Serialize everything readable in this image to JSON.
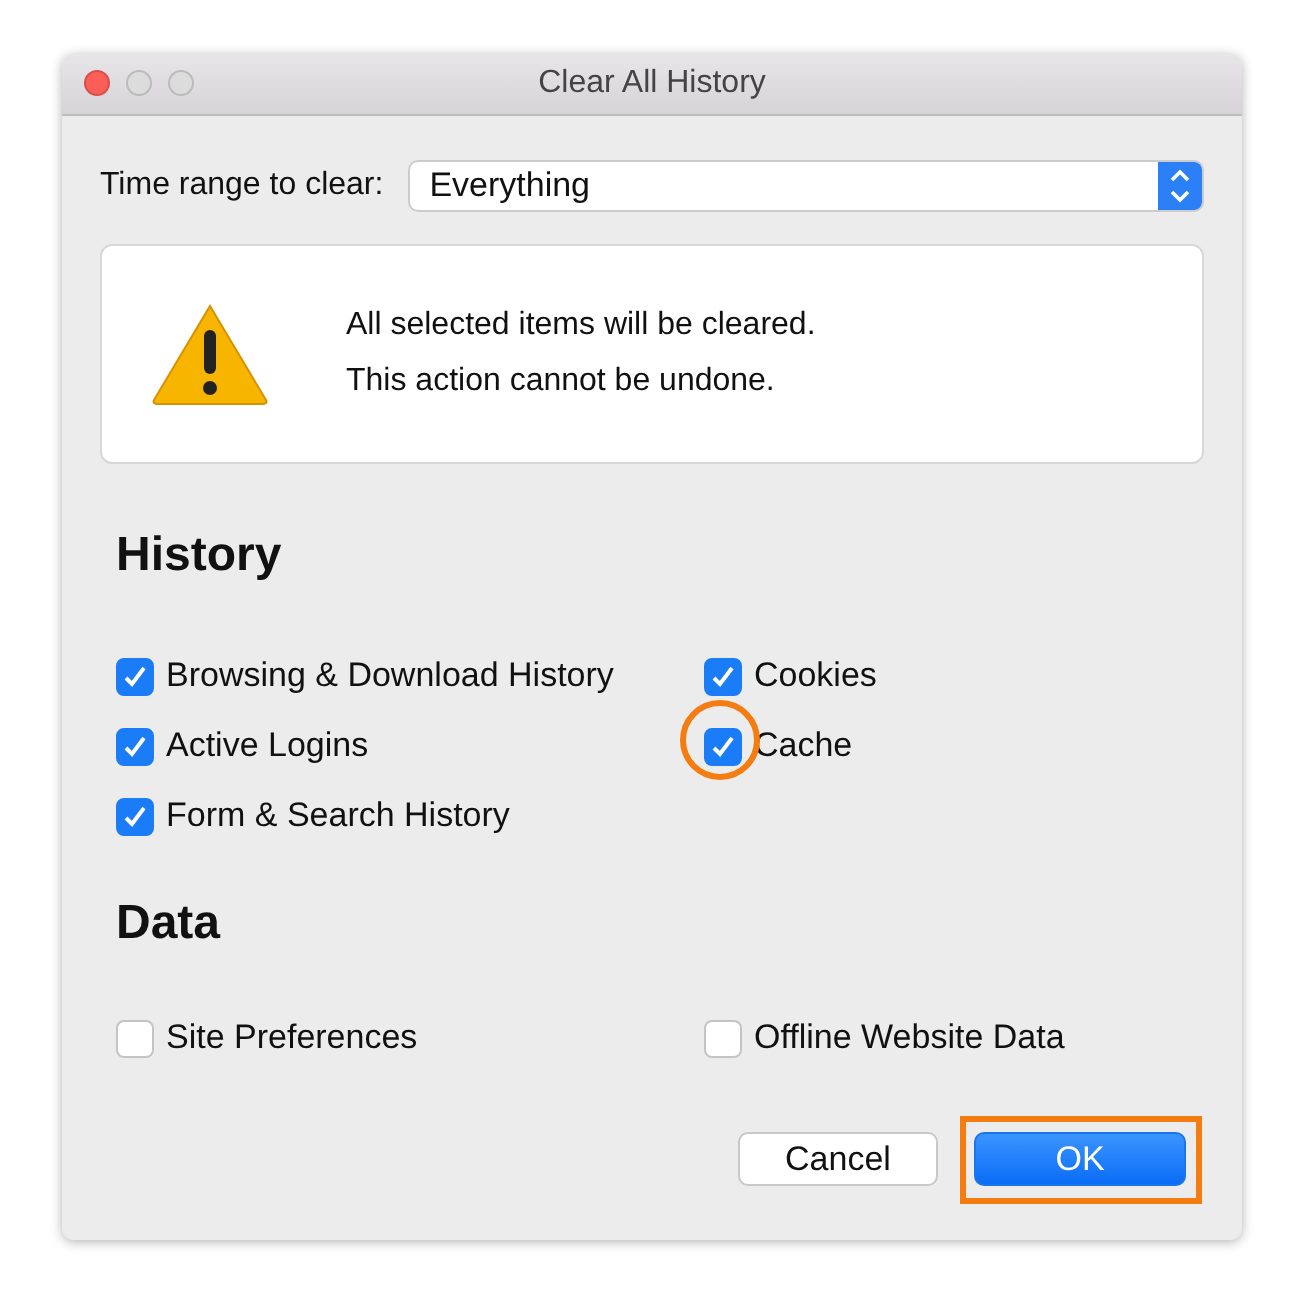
{
  "window": {
    "title": "Clear All History"
  },
  "time_range": {
    "label": "Time range to clear:",
    "value": "Everything"
  },
  "warning": {
    "lines": [
      "All selected items will be cleared.",
      "This action cannot be undone."
    ]
  },
  "sections": [
    {
      "heading": "History",
      "items": [
        {
          "label": "Browsing & Download History",
          "checked": true,
          "highlighted": false
        },
        {
          "label": "Cookies",
          "checked": true,
          "highlighted": false
        },
        {
          "label": "Active Logins",
          "checked": true,
          "highlighted": false
        },
        {
          "label": "Cache",
          "checked": true,
          "highlighted": true
        },
        {
          "label": "Form & Search History",
          "checked": true,
          "highlighted": false
        }
      ]
    },
    {
      "heading": "Data",
      "items": [
        {
          "label": "Site Preferences",
          "checked": false,
          "highlighted": false
        },
        {
          "label": "Offline Website Data",
          "checked": false,
          "highlighted": false
        }
      ]
    }
  ],
  "buttons": [
    {
      "label": "Cancel",
      "kind": "secondary",
      "highlighted": false
    },
    {
      "label": "OK",
      "kind": "primary",
      "highlighted": true
    }
  ]
}
